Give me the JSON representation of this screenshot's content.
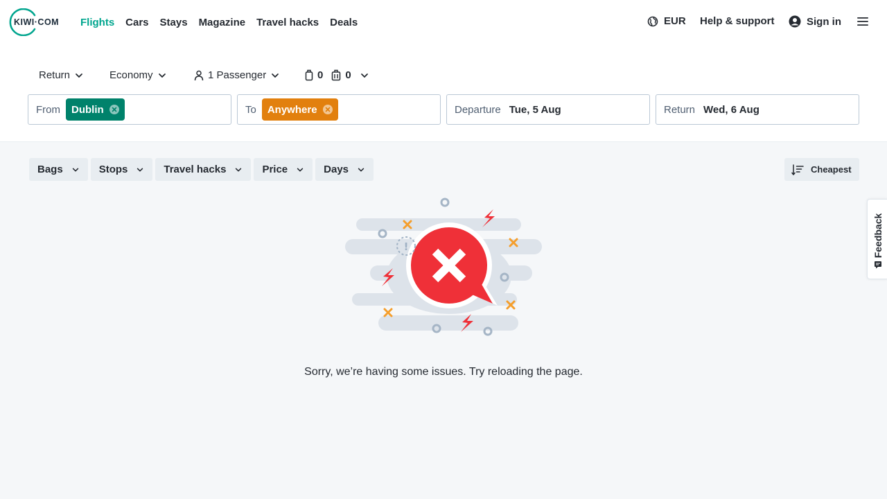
{
  "header": {
    "logo_text": "KIWI·COM",
    "nav": [
      {
        "label": "Flights",
        "active": true
      },
      {
        "label": "Cars"
      },
      {
        "label": "Stays"
      },
      {
        "label": "Magazine"
      },
      {
        "label": "Travel hacks"
      },
      {
        "label": "Deals"
      }
    ],
    "currency": "EUR",
    "help": "Help & support",
    "sign_in": "Sign in"
  },
  "search": {
    "trip_type": "Return",
    "cabin": "Economy",
    "passengers": "1 Passenger",
    "cabin_bags": "0",
    "checked_bags": "0",
    "from_label": "From",
    "from_value": "Dublin",
    "to_label": "To",
    "to_value": "Anywhere",
    "departure_label": "Departure",
    "departure_value": "Tue, 5 Aug",
    "return_label": "Return",
    "return_value": "Wed, 6 Aug"
  },
  "filters": [
    "Bags",
    "Stops",
    "Travel hacks",
    "Price",
    "Days"
  ],
  "sort_label": "Cheapest",
  "error_message": "Sorry, we’re having some issues. Try reloading the page.",
  "feedback_label": "Feedback",
  "colors": {
    "brand": "#00a58e",
    "from_chip": "#00826b",
    "to_chip": "#e2800e",
    "error_red": "#ef3038",
    "accent_orange": "#f59e2b"
  },
  "icons": [
    "globe-icon",
    "user-circle-icon",
    "hamburger-menu-icon",
    "person-icon",
    "cabin-bag-icon",
    "checked-bag-icon",
    "chevron-down-icon",
    "close-circle-icon",
    "sort-icon",
    "feedback-icon",
    "error-illustration"
  ]
}
